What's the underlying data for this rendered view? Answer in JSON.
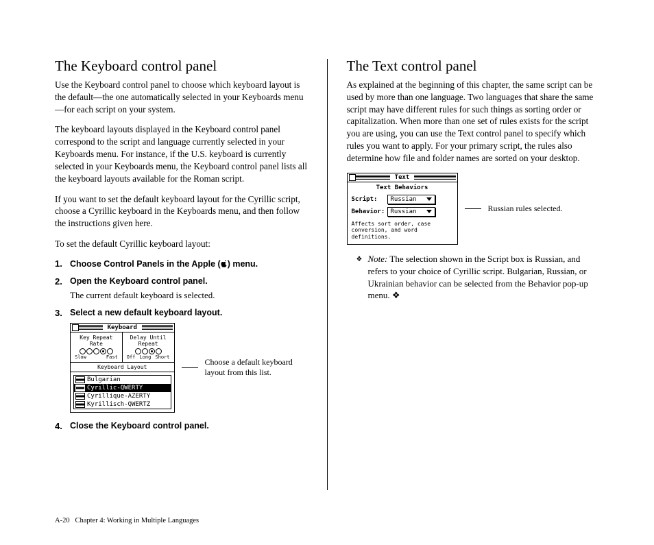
{
  "left": {
    "heading": "The Keyboard control panel",
    "p1": "Use the Keyboard control panel to choose which keyboard layout is the default—the one automatically selected in your Keyboards menu—for each script on your system.",
    "p2": "The keyboard layouts displayed in the Keyboard control panel correspond to the script and language currently selected in your Keyboards menu. For instance, if the U.S. keyboard is currently selected in your Keyboards menu, the Keyboard control panel lists all the keyboard layouts available for the Roman script.",
    "p3": "If you want to set the default keyboard layout for the Cyrillic script, choose a Cyrillic keyboard in the Keyboards menu, and then follow the instructions given here.",
    "p4": "To set the default Cyrillic keyboard layout:",
    "steps": {
      "s1_pre": "Choose Control Panels in the Apple (",
      "s1_post": ") menu.",
      "s2": "Open the Keyboard control panel.",
      "s2_body": "The current default keyboard is selected.",
      "s3": "Select a new default keyboard layout.",
      "s4": "Close the Keyboard control panel."
    },
    "panel": {
      "title": "Keyboard",
      "rate_label": "Key Repeat Rate",
      "rate_left": "Slow",
      "rate_right": "Fast",
      "delay_label": "Delay Until Repeat",
      "delay_off": "Off",
      "delay_long": "Long",
      "delay_short": "Short",
      "layout_label": "Keyboard Layout",
      "items": [
        "Bulgarian",
        "Cyrillic-QWERTY",
        "Cyrillique-AZERTY",
        "Kyrillisch-QWERTZ"
      ]
    },
    "callout": "Choose a default keyboard layout from this list."
  },
  "right": {
    "heading": "The Text control panel",
    "p1": "As explained at the beginning of this chapter, the same script can be used by more than one language. Two languages that share the same script may have different rules for such things as sorting order or capitalization. When more than one set of rules exists for the script you are using, you can use the Text control panel to specify which rules you want to apply. For your primary script, the rules also determine how file and folder names are sorted on your desktop.",
    "panel": {
      "title": "Text",
      "behaviors": "Text Behaviors",
      "script_label": "Script:",
      "script_value": "Russian",
      "behavior_label": "Behavior:",
      "behavior_value": "Russian",
      "footnote": "Affects sort order, case conversion, and word definitions."
    },
    "callout": "Russian rules selected.",
    "note_label": "Note:",
    "note_body": " The selection shown in the Script box is Russian, and refers to your choice of Cyrillic script. Bulgarian, Russian, or Ukrainian behavior can be selected from the Behavior pop-up menu.  ❖"
  },
  "footer": {
    "page": "A-20",
    "chapter": "Chapter 4: Working in Multiple Languages"
  }
}
